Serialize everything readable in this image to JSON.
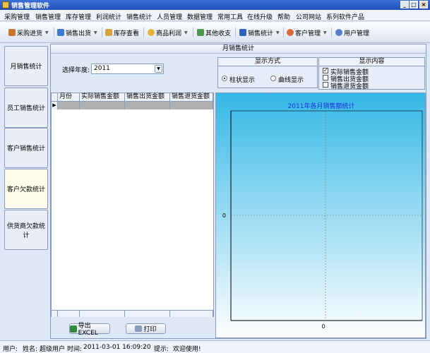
{
  "window": {
    "title": "销售管理软件",
    "minimize": "_",
    "maximize": "□",
    "close": "×"
  },
  "menu": [
    "采购管理",
    "销售管理",
    "库存管理",
    "利润统计",
    "销售统计",
    "人员管理",
    "数据管理",
    "常用工具",
    "在线升级",
    "帮助",
    "公司网站",
    "系列软件产品"
  ],
  "toolbar": {
    "purchase": "采购进货",
    "sales_out": "销售出货",
    "stock_view": "库存查看",
    "profit": "商品利润",
    "other": "其他收支",
    "sales_stats": "销售统计",
    "customer": "客户管理",
    "users": "用户管理"
  },
  "nav": [
    "月销售统计",
    "员工销售统计",
    "客户销售统计",
    "客户欠款统计",
    "供货商欠款统计"
  ],
  "main": {
    "title": "月销售统计",
    "year_label": "选择年度:",
    "year_value": "2011",
    "display_mode": {
      "title": "显示方式",
      "bar": "柱状显示",
      "line": "曲线显示"
    },
    "display_content": {
      "title": "显示内容",
      "actual": "实际销售金额",
      "out": "销售出货金额",
      "returned": "销售退货金额"
    },
    "grid_headers": [
      "月份",
      "实际销售金额",
      "销售出货金额",
      "销售退货金额"
    ],
    "export_label": "导出EXCEL",
    "print_label": "打印"
  },
  "chart_data": {
    "type": "bar",
    "title": "2011年各月销售额统计",
    "x_tick": "0",
    "y_tick": "0",
    "series": [],
    "grid": true
  },
  "status": {
    "user_label": "用户:",
    "name_label": "姓名:",
    "name_value": "超级用户",
    "time_label": "时间:",
    "time_value": "2011-03-01 16:09:20",
    "hint_label": "提示:",
    "hint_value": "欢迎使用!"
  },
  "colors": {
    "chart_top": "#35b8e6",
    "chart_title": "#1c2ed8",
    "titlebar": "#2a5cc8"
  }
}
